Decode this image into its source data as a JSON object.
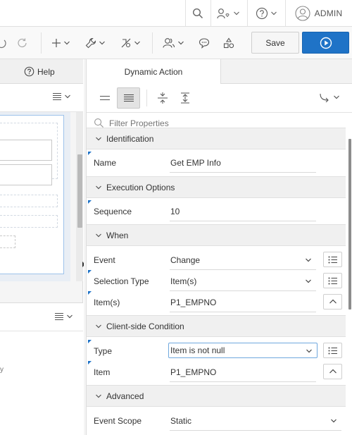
{
  "header": {
    "user_label": "ADMIN"
  },
  "toolbar": {
    "save_label": "Save"
  },
  "left_panel": {
    "help_tab_label": "Help",
    "canvas_fragment_text": "y"
  },
  "right_panel": {
    "tab_label": "Dynamic Action",
    "filter_placeholder": "Filter Properties"
  },
  "properties": {
    "identification": {
      "title": "Identification",
      "name_label": "Name",
      "name_value": "Get EMP Info"
    },
    "execution": {
      "title": "Execution Options",
      "sequence_label": "Sequence",
      "sequence_value": "10"
    },
    "when": {
      "title": "When",
      "event_label": "Event",
      "event_value": "Change",
      "selection_type_label": "Selection Type",
      "selection_type_value": "Item(s)",
      "items_label": "Item(s)",
      "items_value": "P1_EMPNO"
    },
    "client_condition": {
      "title": "Client-side Condition",
      "type_label": "Type",
      "type_value": "Item is not null",
      "item_label": "Item",
      "item_value": "P1_EMPNO"
    },
    "advanced": {
      "title": "Advanced",
      "event_scope_label": "Event Scope",
      "event_scope_value": "Static"
    }
  },
  "colors": {
    "accent": "#1f73c7",
    "section_bg": "#f0f0f0"
  }
}
